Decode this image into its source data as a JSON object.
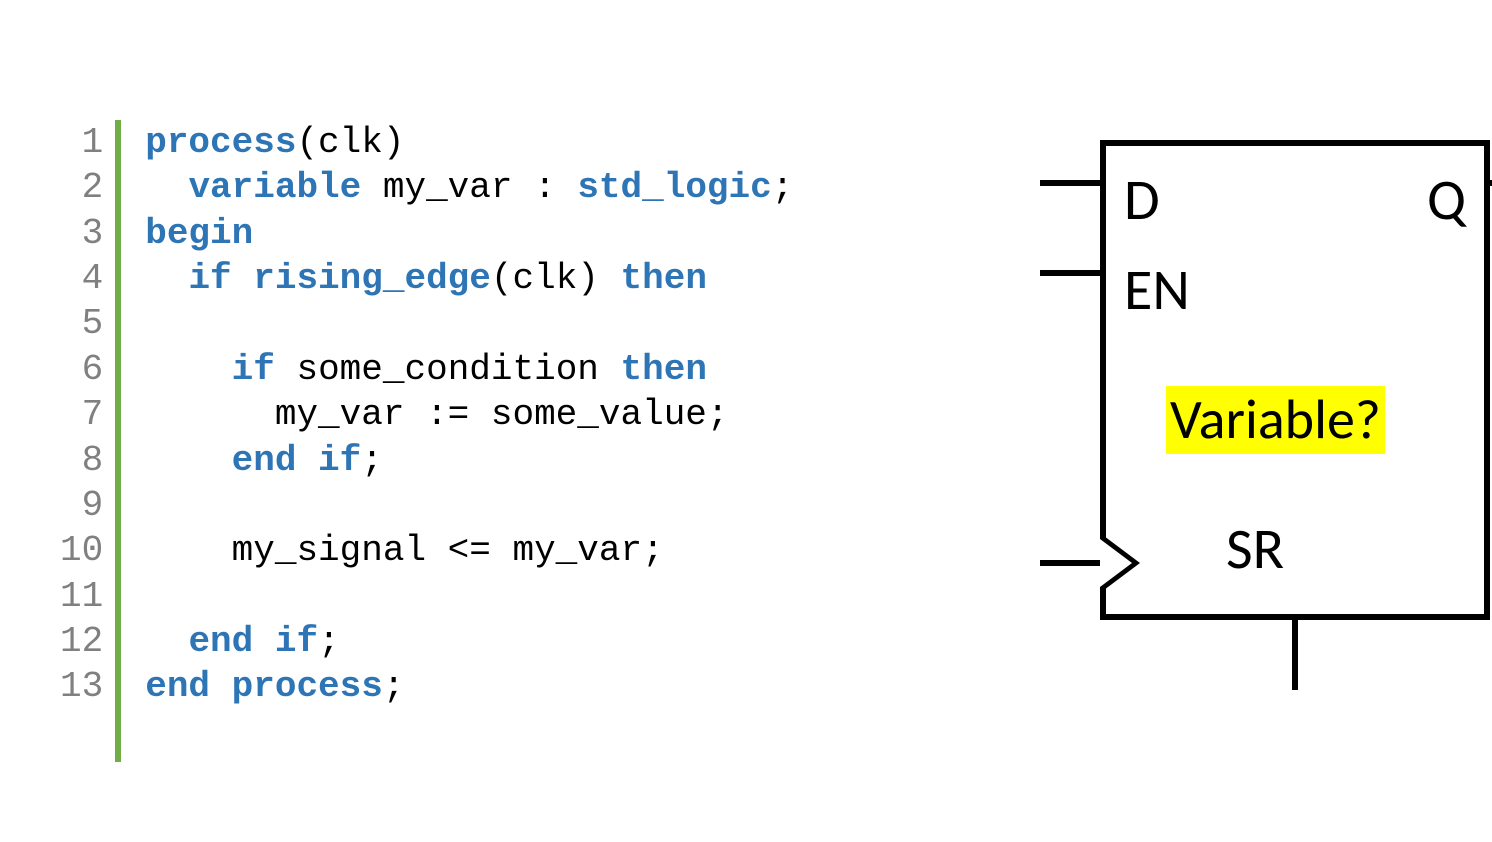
{
  "code": {
    "line_numbers": [
      "1",
      "2",
      "3",
      "4",
      "5",
      "6",
      "7",
      "8",
      "9",
      "10",
      "11",
      "12",
      "13"
    ],
    "tokens": [
      [
        {
          "t": "process",
          "c": "kw"
        },
        {
          "t": "(clk)",
          "c": ""
        }
      ],
      [
        {
          "t": "  ",
          "c": ""
        },
        {
          "t": "variable",
          "c": "kw"
        },
        {
          "t": " my_var : ",
          "c": ""
        },
        {
          "t": "std_logic",
          "c": "kw"
        },
        {
          "t": ";",
          "c": ""
        }
      ],
      [
        {
          "t": "begin",
          "c": "kw"
        }
      ],
      [
        {
          "t": "  ",
          "c": ""
        },
        {
          "t": "if rising_edge",
          "c": "kw"
        },
        {
          "t": "(clk) ",
          "c": ""
        },
        {
          "t": "then",
          "c": "kw"
        }
      ],
      [
        {
          "t": "",
          "c": ""
        }
      ],
      [
        {
          "t": "    ",
          "c": ""
        },
        {
          "t": "if",
          "c": "kw"
        },
        {
          "t": " some_condition ",
          "c": ""
        },
        {
          "t": "then",
          "c": "kw"
        }
      ],
      [
        {
          "t": "      my_var := some_value;",
          "c": ""
        }
      ],
      [
        {
          "t": "    ",
          "c": ""
        },
        {
          "t": "end if",
          "c": "kw"
        },
        {
          "t": ";",
          "c": ""
        }
      ],
      [
        {
          "t": "",
          "c": ""
        }
      ],
      [
        {
          "t": "    my_signal <= my_var;",
          "c": ""
        }
      ],
      [
        {
          "t": "",
          "c": ""
        }
      ],
      [
        {
          "t": "  ",
          "c": ""
        },
        {
          "t": "end if",
          "c": "kw"
        },
        {
          "t": ";",
          "c": ""
        }
      ],
      [
        {
          "t": "end process",
          "c": "kw"
        },
        {
          "t": ";",
          "c": ""
        }
      ]
    ]
  },
  "diagram": {
    "ports": {
      "D": "D",
      "Q": "Q",
      "EN": "EN",
      "SR": "SR"
    },
    "highlight": "Variable?"
  }
}
